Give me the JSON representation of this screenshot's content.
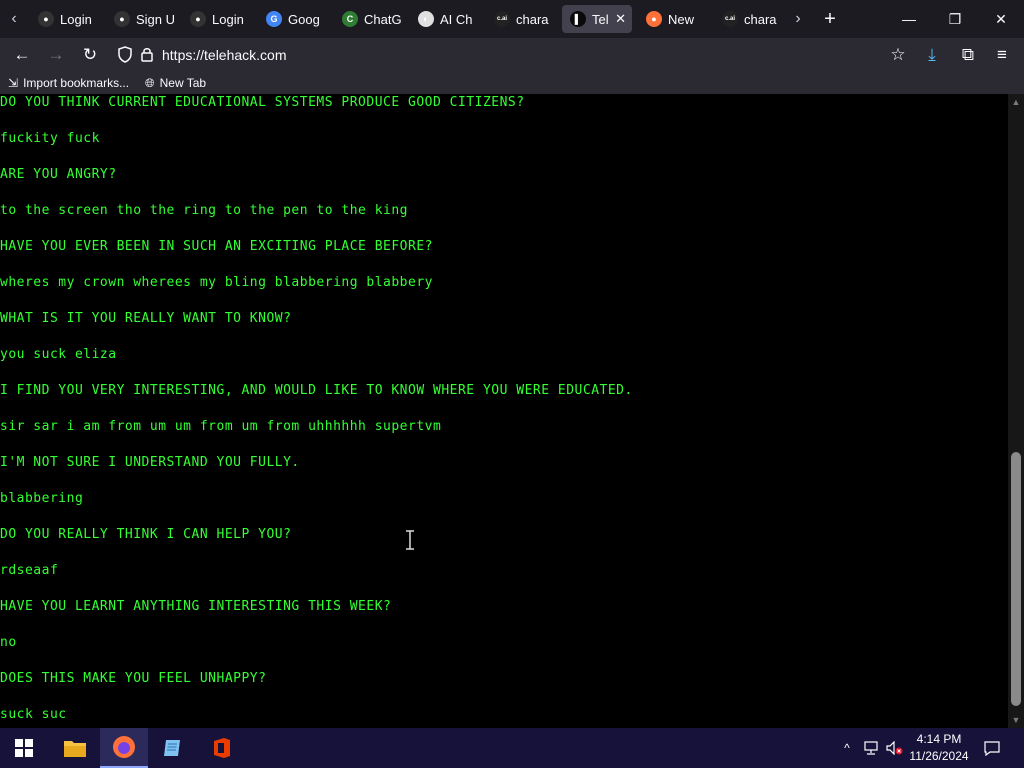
{
  "tabs": [
    {
      "label": "Login",
      "icon": "github-icon",
      "color": "#333333",
      "glyph": "●"
    },
    {
      "label": "Sign U",
      "icon": "github-icon",
      "color": "#333333",
      "glyph": "●"
    },
    {
      "label": "Login",
      "icon": "github-icon",
      "color": "#333333",
      "glyph": "●"
    },
    {
      "label": "Goog",
      "icon": "google-translate-icon",
      "color": "#4285f4",
      "glyph": "G"
    },
    {
      "label": "ChatG",
      "icon": "chatgpt-icon",
      "color": "#2e7d32",
      "glyph": "C"
    },
    {
      "label": "AI Ch",
      "icon": "ai-chat-icon",
      "color": "#e0e0e0",
      "glyph": "◐"
    },
    {
      "label": "chara",
      "icon": "character-ai-icon",
      "color": "#222222",
      "glyph": "c.ai"
    },
    {
      "label": "Tel",
      "icon": "telehack-icon",
      "color": "#0a0a0a",
      "glyph": "▌"
    },
    {
      "label": "New",
      "icon": "firefox-icon",
      "color": "#ff7139",
      "glyph": "●"
    },
    {
      "label": "chara",
      "icon": "character-ai-icon",
      "color": "#222222",
      "glyph": "c.ai"
    }
  ],
  "active_tab_index": 7,
  "url": "https://telehack.com",
  "bookmarks": {
    "import": "Import bookmarks...",
    "new_tab": "New Tab"
  },
  "terminal": {
    "text_color": "#33ff33",
    "lines": [
      "DO YOU THINK CURRENT EDUCATIONAL SYSTEMS PRODUCE GOOD CITIZENS?",
      "fuckity fuck",
      "ARE YOU ANGRY?",
      "to the screen tho the ring to the pen to the king",
      "HAVE YOU EVER BEEN IN SUCH AN EXCITING PLACE BEFORE?",
      "wheres my crown wherees my bling blabbering blabbery",
      "WHAT IS IT YOU REALLY WANT TO KNOW?",
      "you suck eliza",
      "I FIND YOU VERY INTERESTING, AND WOULD LIKE TO KNOW WHERE YOU WERE EDUCATED.",
      "sir sar i am from um um from um from uhhhhhh supertvm",
      "I'M NOT SURE I UNDERSTAND YOU FULLY.",
      "blabbering",
      "DO YOU REALLY THINK I CAN HELP YOU?",
      "rdseaaf",
      "HAVE YOU LEARNT ANYTHING INTERESTING THIS WEEK?",
      "no",
      "DOES THIS MAKE YOU FEEL UNHAPPY?",
      "suck suc"
    ]
  },
  "clock": {
    "time": "4:14 PM",
    "date": "11/26/2024"
  }
}
